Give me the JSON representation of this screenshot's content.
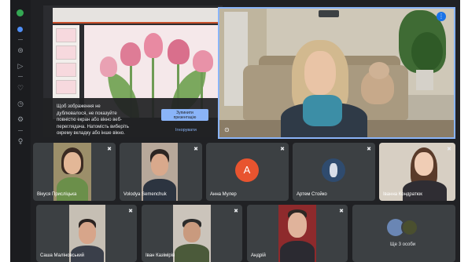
{
  "rail": {
    "icons": [
      "meet-icon",
      "chat-icon",
      "send-icon",
      "heart-icon",
      "clock-icon",
      "settings-icon",
      "lightbulb-icon"
    ]
  },
  "presentation": {
    "message": "Щоб зображення не\nдублювалося, не показуйте\nповністю екран або вікно веб-\nпереглядача. Натомість виберіть\nокрему вкладку або інше вікно.",
    "stop_button": "Зупинити\nпрезентацію",
    "ignore_link": "Ігнорувати"
  },
  "participants": [
    {
      "name": "Вікуся Присліцька",
      "muted": true
    },
    {
      "name": "Volodya Semenchuk",
      "muted": true
    },
    {
      "name": "Анна Мулер",
      "muted": true,
      "avatar_letter": "A",
      "avatar_color": "#e8542f"
    },
    {
      "name": "Артем Стойко",
      "muted": true
    },
    {
      "name": "Іванна Кондратюк",
      "muted": true
    },
    {
      "name": "Саша Маліновський",
      "muted": true
    },
    {
      "name": "Іван Казімірів",
      "muted": true
    },
    {
      "name": "Андрій",
      "muted": true
    }
  ],
  "more_people": {
    "label": "Ще 3 особи"
  },
  "colors": {
    "accent": "#8ab4f8",
    "tile_bg": "#3c4043",
    "app_bg": "#202124",
    "active_dot": "#34a853"
  }
}
